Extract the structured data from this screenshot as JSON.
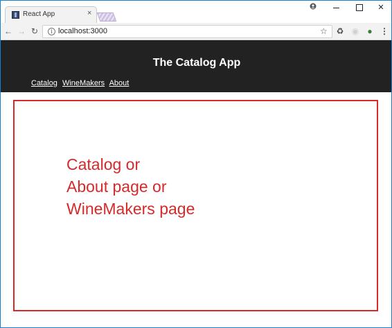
{
  "browser": {
    "tab_title": "React App",
    "tab_close": "×",
    "url": "localhost:3000",
    "icons": {
      "back": "arrow-left-icon",
      "forward": "arrow-right-icon",
      "reload": "reload-icon",
      "info": "info-icon",
      "bookmark": "star-icon",
      "menu": "kebab-menu-icon"
    }
  },
  "app": {
    "title": "The Catalog App",
    "nav": [
      "Catalog",
      "WineMakers",
      "About"
    ]
  },
  "placeholder": {
    "lines": [
      "Catalog or",
      "About page or",
      "WineMakers page"
    ],
    "color": "#d62a2a"
  }
}
